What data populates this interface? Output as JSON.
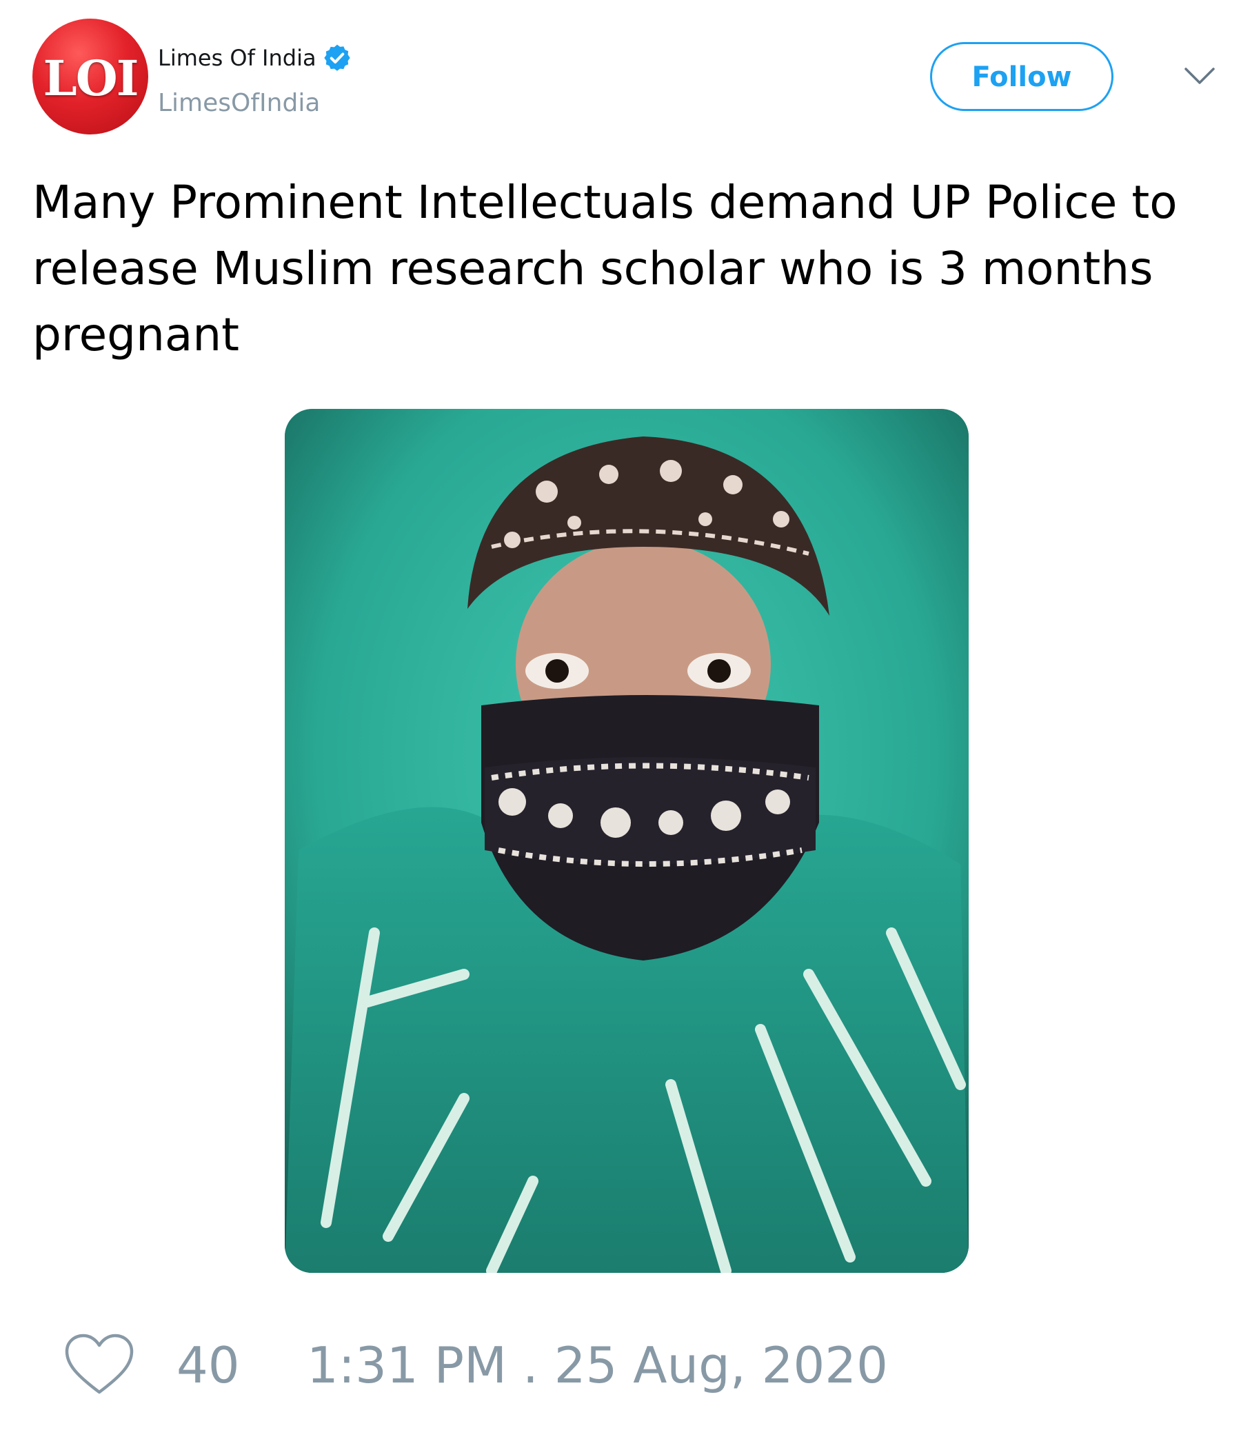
{
  "header": {
    "avatar_text": "LOI",
    "display_name": "Limes Of India",
    "handle": "LimesOfIndia",
    "follow_label": "Follow",
    "verified_icon": "verified-badge-icon",
    "menu_icon": "chevron-down-icon"
  },
  "tweet": {
    "text": "Many Prominent Intellectuals demand UP Police to\nrelease Muslim research scholar who is 3 months\npregnant"
  },
  "footer": {
    "like_icon": "heart-outline-icon",
    "like_count": "40",
    "timestamp": "1:31 PM . 25 Aug, 2020"
  },
  "colors": {
    "accent": "#1da1f2",
    "muted": "#8899a6",
    "avatar_red": "#e3222a",
    "media_teal": "#2fae9a"
  }
}
